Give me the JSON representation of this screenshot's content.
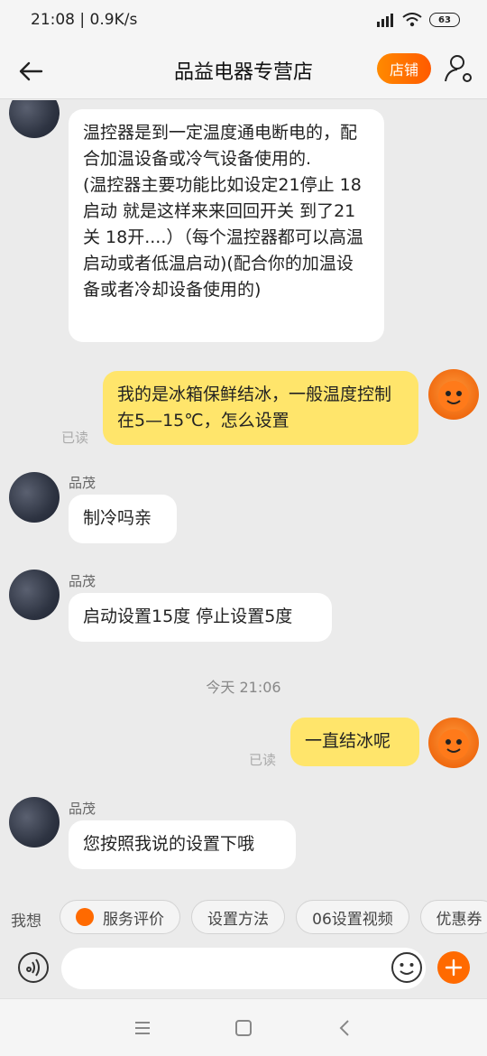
{
  "status": {
    "time": "21:08",
    "speed": "0.9K/s",
    "battery": "63"
  },
  "header": {
    "title": "品益电器专营店",
    "shop_label": "店铺"
  },
  "messages": [
    {
      "id": "m1",
      "text": "温控器是到一定温度通电断电的，配合加温设备或冷气设备使用的.　　 (温控器主要功能比如设定21停止 18启动 就是这样来来回回开关 到了21关 18开....）（每个温控器都可以高温启动或者低温启动)(配合你的加温设备或者冷却设备使用的)"
    },
    {
      "id": "m2",
      "text": "我的是冰箱保鲜结冰，一般温度控制在5—15℃，怎么设置",
      "read": "已读"
    },
    {
      "id": "m3",
      "sender": "品茂",
      "text": "制冷吗亲"
    },
    {
      "id": "m4",
      "sender": "品茂",
      "text": "启动设置15度 停止设置5度"
    },
    {
      "id": "m5",
      "text": "一直结冰呢",
      "read": "已读"
    },
    {
      "id": "m6",
      "sender": "品茂",
      "text": "您按照我说的设置下哦"
    }
  ],
  "time_separator": "今天  21:06",
  "quick": {
    "label": "我想",
    "chips": [
      "服务评价",
      "设置方法",
      "06设置视频",
      "优惠券"
    ]
  },
  "input": {
    "placeholder": ""
  }
}
